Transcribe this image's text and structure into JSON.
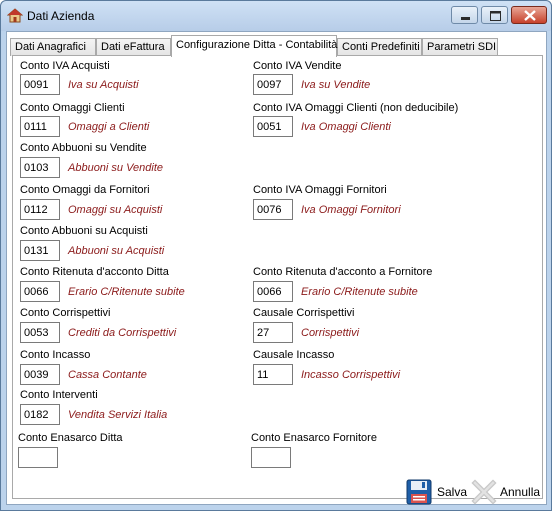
{
  "window": {
    "title": "Dati Azienda"
  },
  "tabs": [
    {
      "label": "Dati Anagrafici"
    },
    {
      "label": "Dati eFattura"
    },
    {
      "label": "Configurazione Ditta - Contabilità"
    },
    {
      "label": "Conti Predefiniti"
    },
    {
      "label": "Parametri SDI"
    }
  ],
  "fields": {
    "iva_acquisti": {
      "label": "Conto IVA Acquisti",
      "code": "0091",
      "desc": "Iva su Acquisti"
    },
    "iva_vendite": {
      "label": "Conto IVA Vendite",
      "code": "0097",
      "desc": "Iva su Vendite"
    },
    "omaggi_clienti": {
      "label": "Conto Omaggi Clienti",
      "code": "0111",
      "desc": "Omaggi  a Clienti"
    },
    "iva_omaggi_clienti": {
      "label": "Conto IVA Omaggi Clienti (non deducibile)",
      "code": "0051",
      "desc": "Iva Omaggi Clienti"
    },
    "abbuoni_vendite": {
      "label": "Conto Abbuoni su Vendite",
      "code": "0103",
      "desc": "Abbuoni su Vendite"
    },
    "omaggi_fornitori": {
      "label": "Conto Omaggi da Fornitori",
      "code": "0112",
      "desc": "Omaggi su Acquisti"
    },
    "iva_omaggi_fornitori": {
      "label": "Conto IVA Omaggi Fornitori",
      "code": "0076",
      "desc": "Iva Omaggi Fornitori"
    },
    "abbuoni_acquisti": {
      "label": "Conto Abbuoni su Acquisti",
      "code": "0131",
      "desc": "Abbuoni su Acquisti"
    },
    "ritenuta_ditta": {
      "label": "Conto Ritenuta d'acconto Ditta",
      "code": "0066",
      "desc": "Erario C/Ritenute subite"
    },
    "ritenuta_fornitore": {
      "label": "Conto Ritenuta d'acconto a Fornitore",
      "code": "0066",
      "desc": "Erario C/Ritenute subite"
    },
    "corrispettivi": {
      "label": "Conto Corrispettivi",
      "code": "0053",
      "desc": "Crediti da Corrispettivi"
    },
    "causale_corrispettivi": {
      "label": "Causale Corrispettivi",
      "code": "27",
      "desc": "Corrispettivi"
    },
    "incasso": {
      "label": "Conto Incasso",
      "code": "0039",
      "desc": "Cassa Contante"
    },
    "causale_incasso": {
      "label": "Causale Incasso",
      "code": "11",
      "desc": "Incasso Corrispettivi"
    },
    "interventi": {
      "label": "Conto Interventi",
      "code": "0182",
      "desc": "Vendita Servizi Italia"
    },
    "enasarco_ditta": {
      "label": "Conto Enasarco Ditta",
      "code": ""
    },
    "enasarco_fornitore": {
      "label": "Conto Enasarco Fornitore",
      "code": ""
    }
  },
  "footer": {
    "save_label": "Salva",
    "cancel_label": "Annulla"
  },
  "colors": {
    "description_text": "#8b1a1a",
    "title_bar": "#b7cde8",
    "close_button": "#c7412b"
  }
}
